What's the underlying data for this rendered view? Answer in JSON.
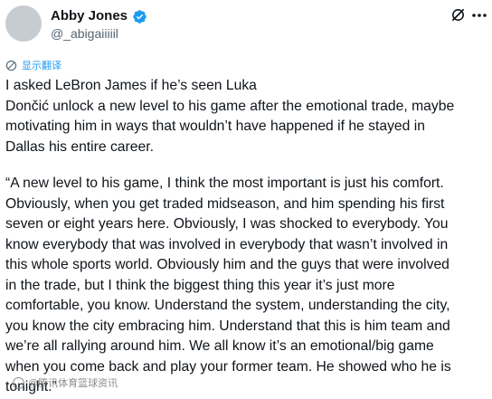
{
  "author": {
    "display_name": "Abby Jones",
    "handle": "@_abigaiiiiil",
    "verified": true
  },
  "icons": {
    "verified": "verified-badge-icon",
    "grok": "grok-icon",
    "more": "more-icon",
    "translate": "translate-icon"
  },
  "translate": {
    "label": "显示翻译"
  },
  "post": {
    "paragraph1": "I asked LeBron James if he’s seen Luka\nDončić unlock a new level to his game after the emotional trade, maybe\nmotivating him in ways that wouldn’t have happened if he stayed in\nDallas his entire career.",
    "paragraph2": "“A new level to his game, I think the most important is just his comfort.\nObviously, when you get traded midseason, and him spending his first\nseven or eight years here. Obviously, I was shocked to everybody. You\nknow everybody that was involved in everybody that wasn’t involved in\nthis whole sports world. Obviously him and the guys that were involved\nin the trade, but I think the biggest thing this year it’s just more\ncomfortable, you know. Understand the system, understanding the city,\nyou know the city embracing him. Understand that this is him team and\nwe’re all rallying around him. We all know it’s an emotional/big game\nwhen you come back and play your former team. He showed who he is\ntonight.”"
  },
  "watermark": {
    "text": "@腾讯体育篮球资讯"
  },
  "colors": {
    "accent": "#1d9bf0",
    "text": "#0f1419",
    "secondary": "#536471"
  }
}
